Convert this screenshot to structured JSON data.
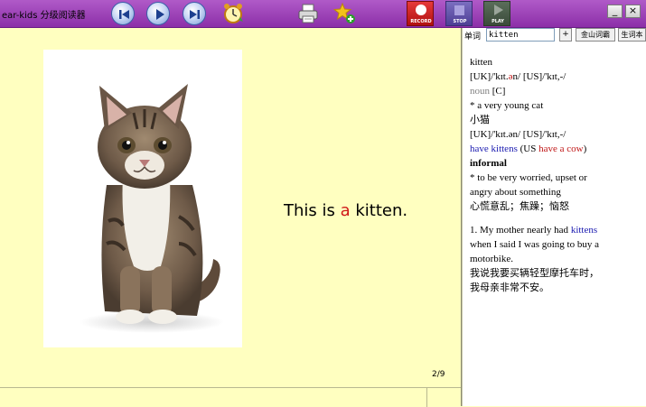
{
  "app": {
    "title": "ear-kids 分级阅读器"
  },
  "toolbar": {
    "rec_label": "RECORD",
    "stop_label": "STOP",
    "play_label": "PLAY",
    "minimize_label": "_",
    "close_label": "×"
  },
  "reader": {
    "sentence_before": "This is ",
    "sentence_highlight": "a",
    "sentence_after": " kitten.",
    "highlight_color": "#d01818",
    "page_counter": "2/9"
  },
  "dictionary": {
    "word_label": "单词",
    "word_value": "kitten",
    "add_button": "+",
    "jinshan_button": "金山词霸",
    "vocab_button": "生词本",
    "entry": {
      "headword": "kitten",
      "phonetic": "[UK]/'kɪt.",
      "phonetic_red": "ə",
      "phonetic_rest": "n/ [US]/'kɪt,-/",
      "pos_gray": "noun ",
      "pos_tag": "[C]",
      "def1": "* a very young cat",
      "def1_cn": "小猫",
      "phonetic2": "[UK]/'kɪt.ən/ [US]/'kɪt,-/",
      "idiom_line_blue": "have kittens",
      "idiom_line_mid": " (US ",
      "idiom_line_red": "have a cow",
      "idiom_line_end": ")",
      "register": "informal",
      "def2_line1": "* to be very worried, upset or",
      "def2_line2": "angry about something",
      "def2_cn": "心慌意乱；焦躁；恼怒",
      "example_pre": "1. My mother nearly had ",
      "example_blue": "kittens",
      "example_line2": "when I said I was going to buy a",
      "example_line3": "motorbike.",
      "example_cn1": "我说我要买辆轻型摩托车时，",
      "example_cn2": "我母亲非常不安。"
    }
  },
  "icons": {
    "prev": "skip-back-icon",
    "play": "play-icon",
    "next": "skip-forward-icon",
    "timer": "alarm-clock-icon",
    "print": "printer-icon",
    "favorite": "star-add-icon"
  },
  "colors": {
    "toolbar": "#9c3fb8",
    "page_background": "#ffffc0",
    "record_red": "#d02020"
  }
}
